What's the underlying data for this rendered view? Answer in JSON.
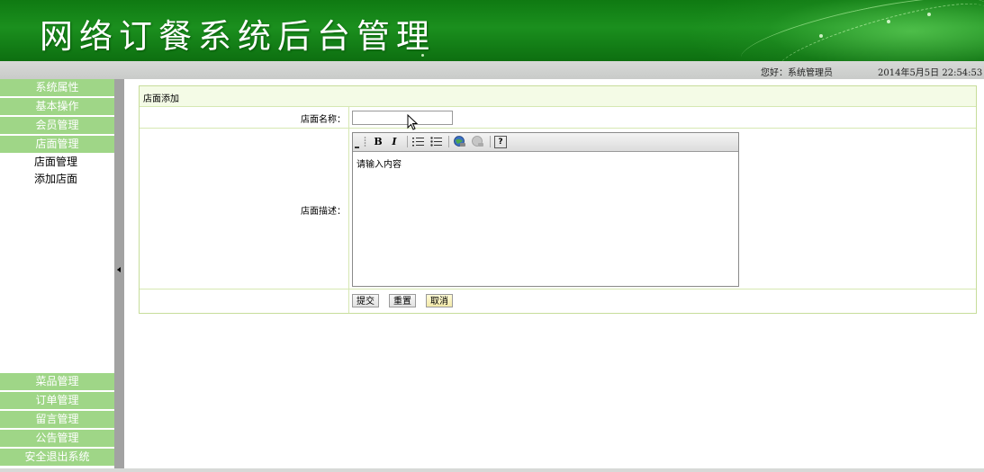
{
  "header": {
    "title": "网络订餐系统后台管理"
  },
  "infobar": {
    "welcome": "您好：系统管理员",
    "datetime": "2014年5月5日  22:54:53"
  },
  "sidebar": {
    "top_menu": [
      "系统属性",
      "基本操作",
      "会员管理",
      "店面管理"
    ],
    "sub_menu": [
      "店面管理",
      "添加店面"
    ],
    "bottom_menu": [
      "菜品管理",
      "订单管理",
      "留言管理",
      "公告管理",
      "安全退出系统"
    ]
  },
  "form": {
    "heading": "店面添加",
    "name_label": "店面名称：",
    "name_value": "",
    "desc_label": "店面描述：",
    "editor_placeholder": "请输入内容",
    "toolbar": {
      "bold": "B",
      "italic": "I",
      "help": "?"
    },
    "buttons": {
      "submit": "提交",
      "reset": "重置",
      "cancel": "取消"
    }
  },
  "colors": {
    "header_green": "#1b8f1e",
    "menu_green": "#9fd687",
    "form_border": "#c7dd9a"
  }
}
